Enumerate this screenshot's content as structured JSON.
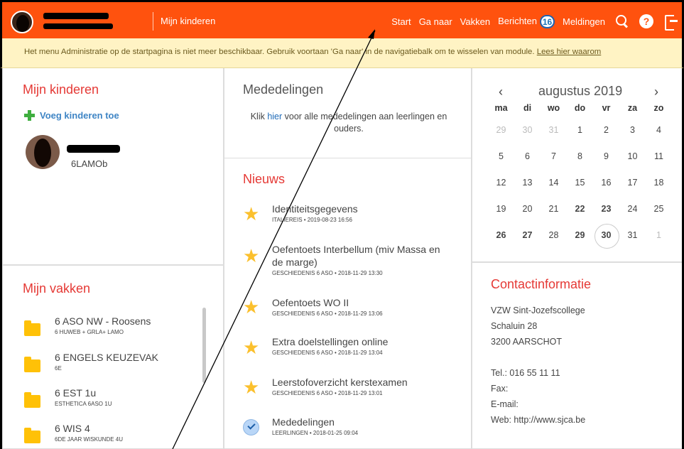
{
  "topbar": {
    "section_link": "Mijn kinderen",
    "nav": [
      {
        "label": "Start"
      },
      {
        "label": "Ga naar"
      },
      {
        "label": "Vakken"
      },
      {
        "label": "Berichten",
        "badge": "16"
      },
      {
        "label": "Meldingen"
      }
    ],
    "icons": [
      "search-icon",
      "help-icon",
      "logout-icon"
    ],
    "accent": "#ff520e"
  },
  "notice": {
    "text": "Het menu Administratie op de startpagina is niet meer beschikbaar. Gebruik voortaan 'Ga naar' in de navigatiebalk om te wisselen van module. ",
    "link": "Lees hier waarom"
  },
  "kids": {
    "title": "Mijn kinderen",
    "add_label": "Voeg kinderen toe",
    "child_class": "6LAMOb"
  },
  "vakken": {
    "title": "Mijn vakken",
    "items": [
      {
        "name": "6 ASO NW - Roosens",
        "sub": "6 HUWEB + GRLA+ LAMO"
      },
      {
        "name": "6 ENGELS KEUZEVAK",
        "sub": "6E"
      },
      {
        "name": "6 EST 1u",
        "sub": "ESTHETICA 6ASO 1U"
      },
      {
        "name": "6 WIS 4",
        "sub": "6DE JAAR WISKUNDE 4U"
      }
    ]
  },
  "mededelingen": {
    "title": "Mededelingen",
    "text_before": "Klik ",
    "link": "hier",
    "text_after": " voor alle mededelingen aan leerlingen en ouders."
  },
  "nieuws": {
    "title": "Nieuws",
    "items": [
      {
        "title": "Identiteitsgegevens",
        "meta": "ITALIEREIS • 2019-08-23 16:56",
        "icon": "star-icon"
      },
      {
        "title": "Oefentoets Interbellum (miv Massa en de marge)",
        "meta": "GESCHIEDENIS 6 ASO • 2018-11-29 13:30",
        "icon": "star-icon"
      },
      {
        "title": "Oefentoets WO II",
        "meta": "GESCHIEDENIS 6 ASO • 2018-11-29 13:06",
        "icon": "star-icon"
      },
      {
        "title": "Extra doelstellingen online",
        "meta": "GESCHIEDENIS 6 ASO • 2018-11-29 13:04",
        "icon": "star-icon"
      },
      {
        "title": "Leerstofoverzicht kerstexamen",
        "meta": "GESCHIEDENIS 6 ASO • 2018-11-29 13:01",
        "icon": "star-icon"
      },
      {
        "title": "Mededelingen",
        "meta": "LEERLINGEN • 2018-01-25 09:04",
        "icon": "check-icon"
      }
    ]
  },
  "calendar": {
    "prev": "‹",
    "next": "›",
    "month": "augustus 2019",
    "weekdays": [
      "ma",
      "di",
      "wo",
      "do",
      "vr",
      "za",
      "zo"
    ],
    "days": [
      {
        "d": "29",
        "muted": true
      },
      {
        "d": "30",
        "muted": true
      },
      {
        "d": "31",
        "muted": true
      },
      {
        "d": "1"
      },
      {
        "d": "2"
      },
      {
        "d": "3"
      },
      {
        "d": "4"
      },
      {
        "d": "5"
      },
      {
        "d": "6"
      },
      {
        "d": "7"
      },
      {
        "d": "8"
      },
      {
        "d": "9"
      },
      {
        "d": "10"
      },
      {
        "d": "11"
      },
      {
        "d": "12"
      },
      {
        "d": "13"
      },
      {
        "d": "14"
      },
      {
        "d": "15"
      },
      {
        "d": "16"
      },
      {
        "d": "17"
      },
      {
        "d": "18"
      },
      {
        "d": "19"
      },
      {
        "d": "20"
      },
      {
        "d": "21"
      },
      {
        "d": "22",
        "bold": true
      },
      {
        "d": "23",
        "bold": true
      },
      {
        "d": "24"
      },
      {
        "d": "25"
      },
      {
        "d": "26",
        "bold": true
      },
      {
        "d": "27",
        "bold": true
      },
      {
        "d": "28"
      },
      {
        "d": "29",
        "bold": true
      },
      {
        "d": "30",
        "bold": true,
        "today": true
      },
      {
        "d": "31"
      },
      {
        "d": "1",
        "muted": true
      }
    ]
  },
  "contact": {
    "title": "Contactinformatie",
    "lines": [
      "VZW Sint-Jozefscollege",
      "Schaluin 28",
      "3200 AARSCHOT",
      "Tel.: 016 55 11 11",
      "Fax:",
      "E-mail:",
      "Web: http://www.sjca.be"
    ]
  }
}
